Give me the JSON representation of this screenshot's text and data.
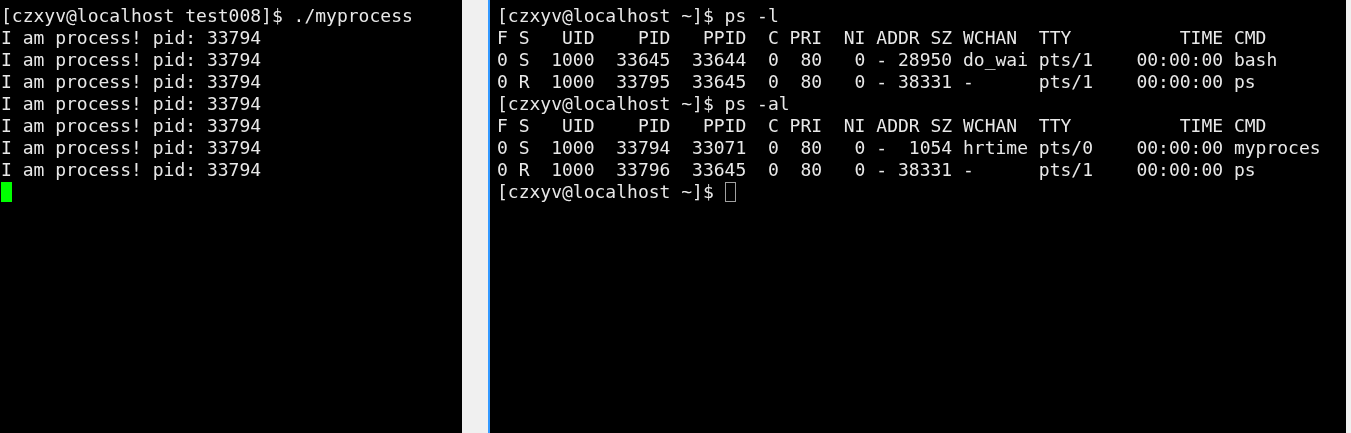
{
  "panes": [
    {
      "lines": [
        {
          "text": "[czxyv@localhost test008]$ ./myprocess"
        },
        {
          "text": "I am process! pid: 33794"
        },
        {
          "text": "I am process! pid: 33794"
        },
        {
          "text": "I am process! pid: 33794"
        },
        {
          "text": "I am process! pid: 33794"
        },
        {
          "text": "I am process! pid: 33794"
        },
        {
          "text": "I am process! pid: 33794"
        },
        {
          "text": "I am process! pid: 33794"
        },
        {
          "cursor": {
            "kind": "filled"
          }
        }
      ]
    },
    {
      "lines": [
        {
          "text": "[czxyv@localhost ~]$ ps -l"
        },
        {
          "text": "F S   UID    PID   PPID  C PRI  NI ADDR SZ WCHAN  TTY          TIME CMD"
        },
        {
          "text": "0 S  1000  33645  33644  0  80   0 - 28950 do_wai pts/1    00:00:00 bash"
        },
        {
          "text": "0 R  1000  33795  33645  0  80   0 - 38331 -      pts/1    00:00:00 ps"
        },
        {
          "text": "[czxyv@localhost ~]$ ps -al"
        },
        {
          "text": "F S   UID    PID   PPID  C PRI  NI ADDR SZ WCHAN  TTY          TIME CMD"
        },
        {
          "text": "0 S  1000  33794  33071  0  80   0 -  1054 hrtime pts/0    00:00:00 myproces"
        },
        {
          "text": "0 R  1000  33796  33645  0  80   0 - 38331 -      pts/1    00:00:00 ps"
        },
        {
          "text": "[czxyv@localhost ~]$ ",
          "cursor": {
            "kind": "outline"
          }
        }
      ]
    }
  ]
}
